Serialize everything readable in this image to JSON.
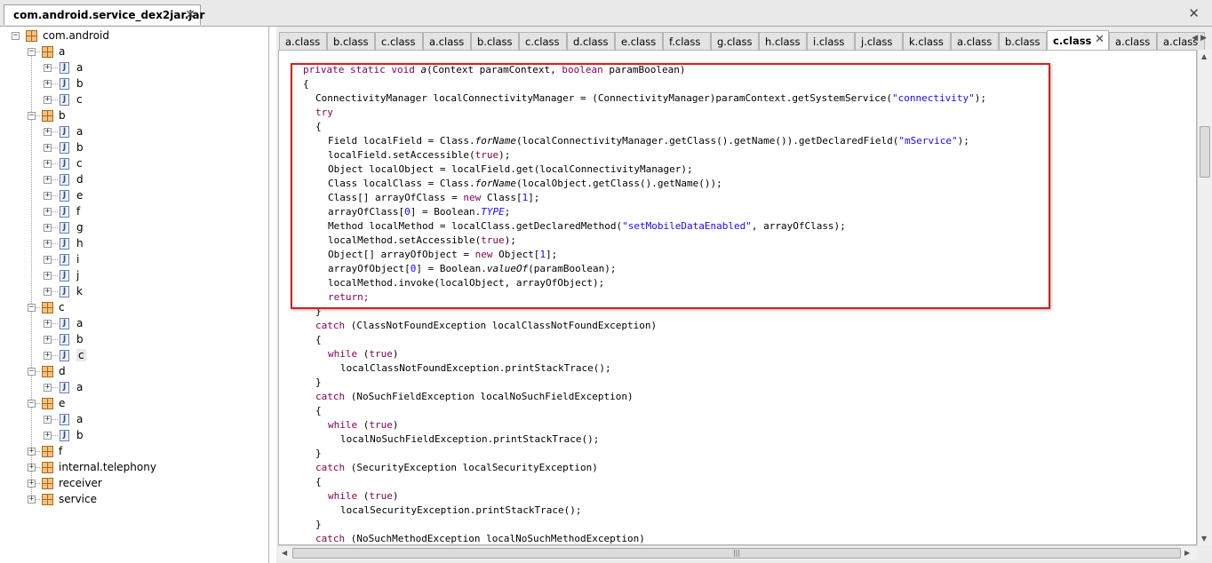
{
  "file_tab": {
    "title": "com.android.service_dex2jar.jar",
    "close": "✕"
  },
  "window_close": "✕",
  "tree": {
    "root": "com.android",
    "a": "a",
    "a_items": [
      "a",
      "b",
      "c"
    ],
    "b": "b",
    "b_items": [
      "a",
      "b",
      "c",
      "d",
      "e",
      "f",
      "g",
      "h",
      "i",
      "j",
      "k"
    ],
    "c": "c",
    "c_items": [
      "a",
      "b",
      "c"
    ],
    "d": "d",
    "d_items": [
      "a"
    ],
    "e": "e",
    "e_items": [
      "a",
      "b"
    ],
    "f": "f",
    "internal": "internal.telephony",
    "receiver": "receiver",
    "service": "service",
    "expanded_glyph": "−",
    "collapsed_glyph": "+",
    "java_glyph": "J"
  },
  "class_tabs": [
    "a.class",
    "b.class",
    "c.class",
    "a.class",
    "b.class",
    "c.class",
    "d.class",
    "e.class",
    "f.class",
    "g.class",
    "h.class",
    "i.class",
    "j.class",
    "k.class",
    "a.class",
    "b.class",
    "c.class",
    "a.class",
    "a.class"
  ],
  "active_tab_index": 16,
  "tab_close": "✕",
  "tab_scroll": "◀ ▶",
  "scroll": {
    "up": "▲",
    "down": "▼",
    "left": "◀",
    "right": "▶",
    "grip": "|||"
  },
  "code": {
    "l1_kw": "private static void ",
    "l1_name": "a",
    "l1_rest": "(Context paramContext, ",
    "l1_kw2": "boolean",
    "l1_end": " paramBoolean)",
    "brace_open": "{",
    "brace_close": "}",
    "l3": "ConnectivityManager localConnectivityManager = (ConnectivityManager)paramContext.getSystemService(",
    "l3_str": "\"connectivity\"",
    "l3_end": ");",
    "try": "try",
    "l6_a": "Field localField = Class.",
    "l6_it": "forName",
    "l6_b": "(localConnectivityManager.getClass().getName()).getDeclaredField(",
    "l6_str": "\"mService\"",
    "l6_c": ");",
    "l7_a": "localField.setAccessible(",
    "l7_kw": "true",
    "l7_b": ");",
    "l8": "Object localObject = localField.get(localConnectivityManager);",
    "l9_a": "Class localClass = Class.",
    "l9_it": "forName",
    "l9_b": "(localObject.getClass().getName());",
    "l10_a": "Class[] arrayOfClass = ",
    "l10_kw": "new",
    "l10_b": " Class[",
    "l10_num": "1",
    "l10_c": "];",
    "l11_a": "arrayOfClass[",
    "l11_num": "0",
    "l11_b": "] = Boolean.",
    "l11_it": "TYPE",
    "l11_c": ";",
    "l12_a": "Method localMethod = localClass.getDeclaredMethod(",
    "l12_str": "\"setMobileDataEnabled\"",
    "l12_b": ", arrayOfClass);",
    "l13_a": "localMethod.setAccessible(",
    "l13_kw": "true",
    "l13_b": ");",
    "l14_a": "Object[] arrayOfObject = ",
    "l14_kw": "new",
    "l14_b": " Object[",
    "l14_num": "1",
    "l14_c": "];",
    "l15_a": "arrayOfObject[",
    "l15_num": "0",
    "l15_b": "] = Boolean.",
    "l15_it": "valueOf",
    "l15_c": "(paramBoolean);",
    "l16": "localMethod.invoke(localObject, arrayOfObject);",
    "return": "return;",
    "catch": "catch",
    "c1": " (ClassNotFoundException localClassNotFoundException)",
    "while": "while",
    "while_a": " (",
    "while_kw": "true",
    "while_b": ")",
    "p1": "localClassNotFoundException.printStackTrace();",
    "c2": " (NoSuchFieldException localNoSuchFieldException)",
    "p2": "localNoSuchFieldException.printStackTrace();",
    "c3": " (SecurityException localSecurityException)",
    "p3": "localSecurityException.printStackTrace();",
    "c4": " (NoSuchMethodException localNoSuchMethodException)"
  }
}
